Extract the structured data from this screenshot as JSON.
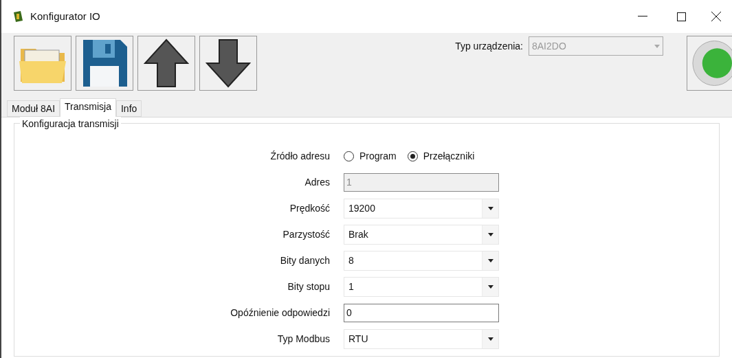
{
  "window": {
    "title": "Konfigurator IO"
  },
  "device": {
    "label": "Typ urządzenia:",
    "value": "8AI2DO",
    "disabled": true
  },
  "status": {
    "on": true
  },
  "tabs": [
    {
      "label": "Moduł 8AI",
      "selected": false
    },
    {
      "label": "Transmisja",
      "selected": true
    },
    {
      "label": "Info",
      "selected": false
    }
  ],
  "group": {
    "title": "Konfiguracja transmisji"
  },
  "rows": [
    {
      "kind": "radio",
      "label": "Źródło adresu",
      "options": [
        {
          "label": "Program",
          "selected": false
        },
        {
          "label": "Przełączniki",
          "selected": true
        }
      ]
    },
    {
      "kind": "text",
      "label": "Adres",
      "value": "1",
      "disabled": true
    },
    {
      "kind": "select",
      "label": "Prędkość",
      "value": "19200"
    },
    {
      "kind": "select",
      "label": "Parzystość",
      "value": "Brak"
    },
    {
      "kind": "select",
      "label": "Bity danych",
      "value": "8"
    },
    {
      "kind": "select",
      "label": "Bity stopu",
      "value": "1"
    },
    {
      "kind": "text",
      "label": "Opóźnienie odpowiedzi",
      "value": "0",
      "disabled": false
    },
    {
      "kind": "select",
      "label": "Typ Modbus",
      "value": "RTU"
    }
  ]
}
